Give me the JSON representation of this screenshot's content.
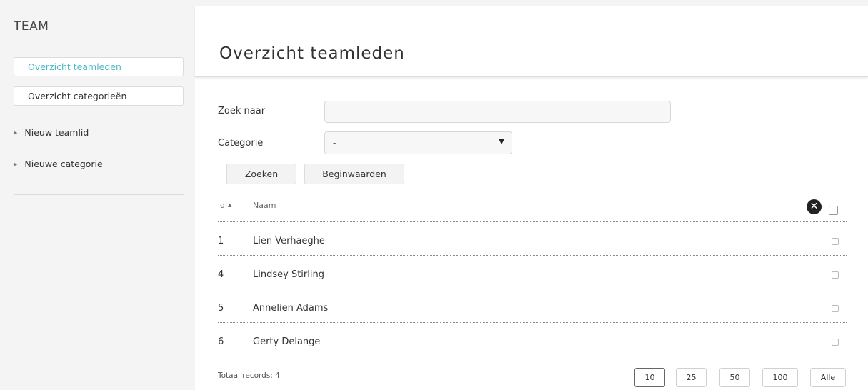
{
  "sidebar": {
    "title": "TEAM",
    "buttons": [
      {
        "label": "Overzicht teamleden",
        "active": true
      },
      {
        "label": "Overzicht categorieën",
        "active": false
      }
    ],
    "links": [
      {
        "label": "Nieuw teamlid"
      },
      {
        "label": "Nieuwe categorie"
      }
    ]
  },
  "header": {
    "title": "Overzicht teamleden"
  },
  "form": {
    "search_label": "Zoek naar",
    "search_value": "",
    "category_label": "Categorie",
    "category_value": "-",
    "search_button": "Zoeken",
    "reset_button": "Beginwaarden"
  },
  "table": {
    "columns": {
      "id": "id",
      "name": "Naam"
    },
    "rows": [
      {
        "id": "1",
        "name": "Lien Verhaeghe"
      },
      {
        "id": "4",
        "name": "Lindsey Stirling"
      },
      {
        "id": "5",
        "name": "Annelien Adams"
      },
      {
        "id": "6",
        "name": "Gerty Delange"
      }
    ],
    "total_text": "Totaal records: 4",
    "page_sizes": [
      "10",
      "25",
      "50",
      "100",
      "Alle"
    ],
    "selected_page_size": "10"
  },
  "icons": {
    "sort": "sort-ascending-icon",
    "clear": "clear-filter-icon",
    "dropdown": "dropdown-arrow-icon",
    "bullet": "triangle-right-icon"
  },
  "colors": {
    "accent": "#4cb8c4",
    "sidebar_bg": "#f4f4f4"
  }
}
